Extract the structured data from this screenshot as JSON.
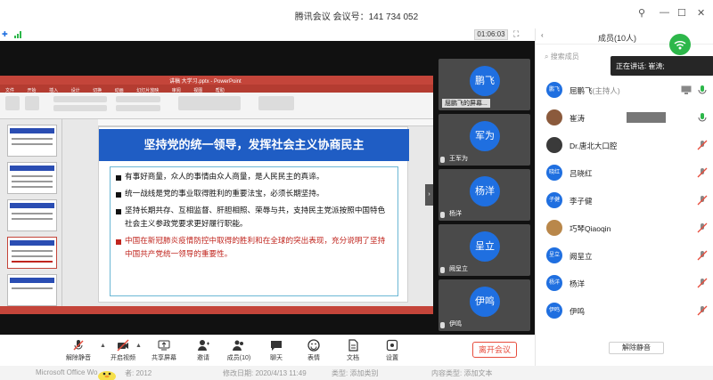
{
  "window": {
    "title": "腾讯会议 会议号：141 734 052",
    "timer": "01:06:03"
  },
  "ppt": {
    "title": "讲稿 大学习.pptx - PowerPoint",
    "tabs": [
      "文件",
      "开始",
      "插入",
      "设计",
      "切换",
      "动画",
      "幻灯片放映",
      "审阅",
      "视图",
      "帮助"
    ]
  },
  "slide": {
    "title": "坚持党的统一领导，发挥社会主义协商民主",
    "bullets": [
      {
        "text": "有事好商量，众人的事情由众人商量，是人民民主的真谛。",
        "red": false
      },
      {
        "text": "统一战线是党的事业取得胜利的重要法宝，必须长期坚持。",
        "red": false
      },
      {
        "text": "坚持长期共存、互相监督、肝胆相照、荣辱与共，支持民主党派按照中国特色社会主义参政党要求更好履行职能。",
        "red": false
      },
      {
        "text": "中国在新冠肺炎疫情防控中取得的胜利和在全球的突出表现，充分说明了坚持中国共产党统一领导的重要性。",
        "red": true
      }
    ]
  },
  "tiles": [
    {
      "avatar": "鹏飞",
      "name": "屈鹏飞的屏幕..."
    },
    {
      "avatar": "军为",
      "name": "王军为"
    },
    {
      "avatar": "杨洋",
      "name": "杨洋"
    },
    {
      "avatar": "呈立",
      "name": "阙呈立"
    },
    {
      "avatar": "伊鸣",
      "name": "伊鸣"
    }
  ],
  "toolbar": {
    "items": [
      {
        "key": "unmute",
        "label": "解除静音"
      },
      {
        "key": "video",
        "label": "开启视频"
      },
      {
        "key": "share",
        "label": "共享屏幕"
      },
      {
        "key": "invite",
        "label": "邀请"
      },
      {
        "key": "members",
        "label": "成员(10)"
      },
      {
        "key": "chat",
        "label": "聊天"
      },
      {
        "key": "emoji",
        "label": "表情"
      },
      {
        "key": "docs",
        "label": "文档"
      },
      {
        "key": "settings",
        "label": "设置"
      }
    ],
    "leave": "离开会议"
  },
  "bgstrip": {
    "app": "Microsoft Office Wo",
    "author": "者: 2012",
    "modified": "修改日期: 2020/4/13 11:49",
    "category": "类型: 添加类别",
    "content": "内容类型: 添加文本"
  },
  "panel": {
    "title": "成员(10人)",
    "search_placeholder": "搜索成员",
    "speaking": "正在讲话: 崔涛;",
    "members": [
      {
        "avatar": "鹏飞",
        "name": "屈鹏飞",
        "tag": "(主持人)",
        "mic": "on",
        "cam": true,
        "photo": false
      },
      {
        "avatar": "",
        "name": "崔涛",
        "tag": "",
        "mic": "on",
        "cam": false,
        "photo": true
      },
      {
        "avatar": "",
        "name": "Dr.唐北大口腔",
        "tag": "",
        "mic": "muted",
        "cam": false,
        "photo": true
      },
      {
        "avatar": "晓红",
        "name": "吕晓红",
        "tag": "",
        "mic": "muted",
        "cam": false,
        "photo": false
      },
      {
        "avatar": "子健",
        "name": "李子健",
        "tag": "",
        "mic": "muted",
        "cam": false,
        "photo": false
      },
      {
        "avatar": "",
        "name": "巧琴Qiaoqin",
        "tag": "",
        "mic": "muted",
        "cam": false,
        "photo": true
      },
      {
        "avatar": "呈立",
        "name": "阙呈立",
        "tag": "",
        "mic": "muted",
        "cam": false,
        "photo": false
      },
      {
        "avatar": "杨洋",
        "name": "杨洋",
        "tag": "",
        "mic": "muted",
        "cam": false,
        "photo": false
      },
      {
        "avatar": "伊鸣",
        "name": "伊鸣",
        "tag": "",
        "mic": "muted",
        "cam": false,
        "photo": false
      }
    ],
    "unmute_all": "解除静音"
  },
  "colors": {
    "accent": "#1f6fe0",
    "slide_title_bg": "#1f5dc4",
    "leave": "#e74c3c",
    "ppt_red": "#c4453a"
  }
}
